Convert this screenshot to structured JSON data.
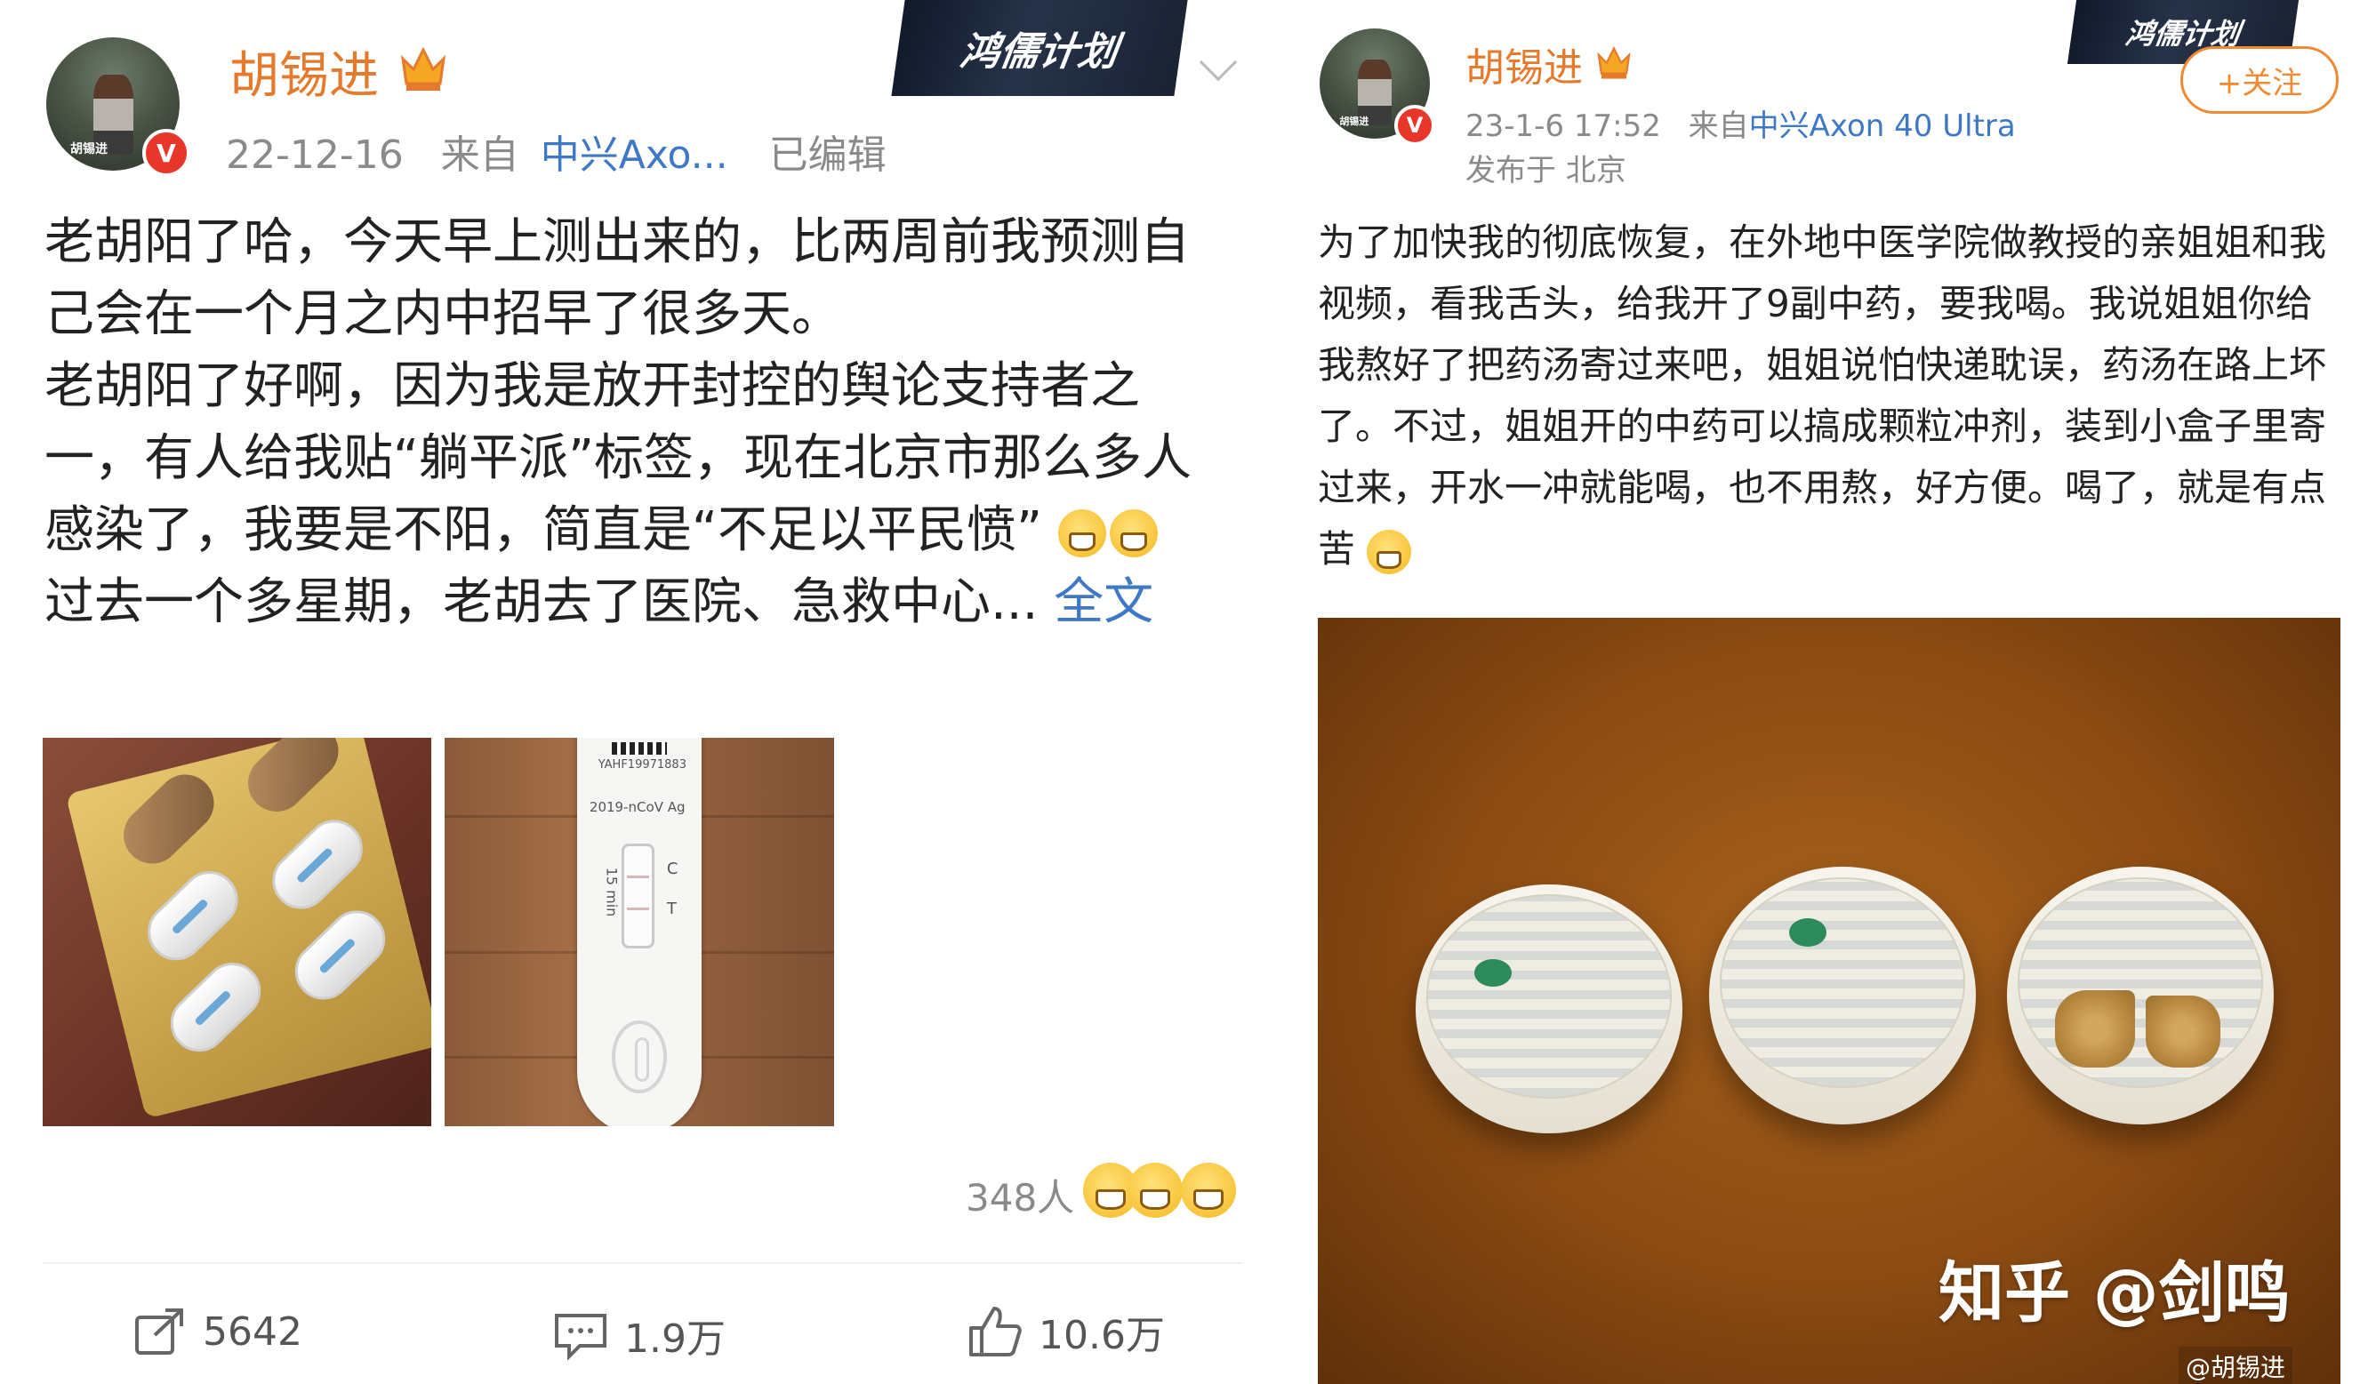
{
  "left_post": {
    "author": "胡锡进",
    "date": "22-12-16",
    "source_prefix": "来自",
    "source_app": "中兴Axo...",
    "edited": "已编辑",
    "banner": "鸿儒计划",
    "verified_badge": "V",
    "avatar_tag": "胡锡进",
    "paragraphs": [
      "老胡阳了哈，今天早上测出来的，比两周前我预测自己会在一个月之内中招早了很多天。",
      "老胡阳了好啊，因为我是放开封控的舆论支持者之一，有人给我贴“躺平派”标签，现在北京市那么多人感染了，我要是不阳，简直是“不足以平民愤”",
      "过去一个多星期，老胡去了医院、急救中心..."
    ],
    "expand_link": "全文",
    "test_strip": {
      "serial": "YAHF19971883",
      "label": "2019-nCoV Ag",
      "time": "15 min",
      "c": "C",
      "t": "T"
    },
    "reactions_count": "348人",
    "actions": {
      "repost": "5642",
      "comment": "1.9万",
      "like": "10.6万"
    }
  },
  "right_post": {
    "author": "胡锡进",
    "datetime": "23-1-6 17:52",
    "source_prefix": "来自",
    "source_app": "中兴Axon 40 Ultra",
    "location": "发布于 北京",
    "follow_button": "+关注",
    "banner": "鸿儒计划",
    "verified_badge": "V",
    "avatar_tag": "胡锡进",
    "text": "为了加快我的彻底恢复，在外地中医学院做教授的亲姐姐和我视频，看我舌头，给我开了9副中药，要我喝。我说姐姐你给我熬好了把药汤寄过来吧，姐姐说怕快递耽误，药汤在路上坏了。不过，姐姐开的中药可以搞成颗粒冲剂，装到小盒子里寄过来，开水一冲就能喝，也不用熬，好方便。喝了，就是有点苦",
    "image_watermark": "知乎 @剑鸣",
    "image_credit": "@胡锡进"
  },
  "colors": {
    "name": "#e57a2c",
    "link": "#3f78c4",
    "meta": "#8a8a8a",
    "badge": "#e8372a",
    "follow": "#f08a34"
  }
}
